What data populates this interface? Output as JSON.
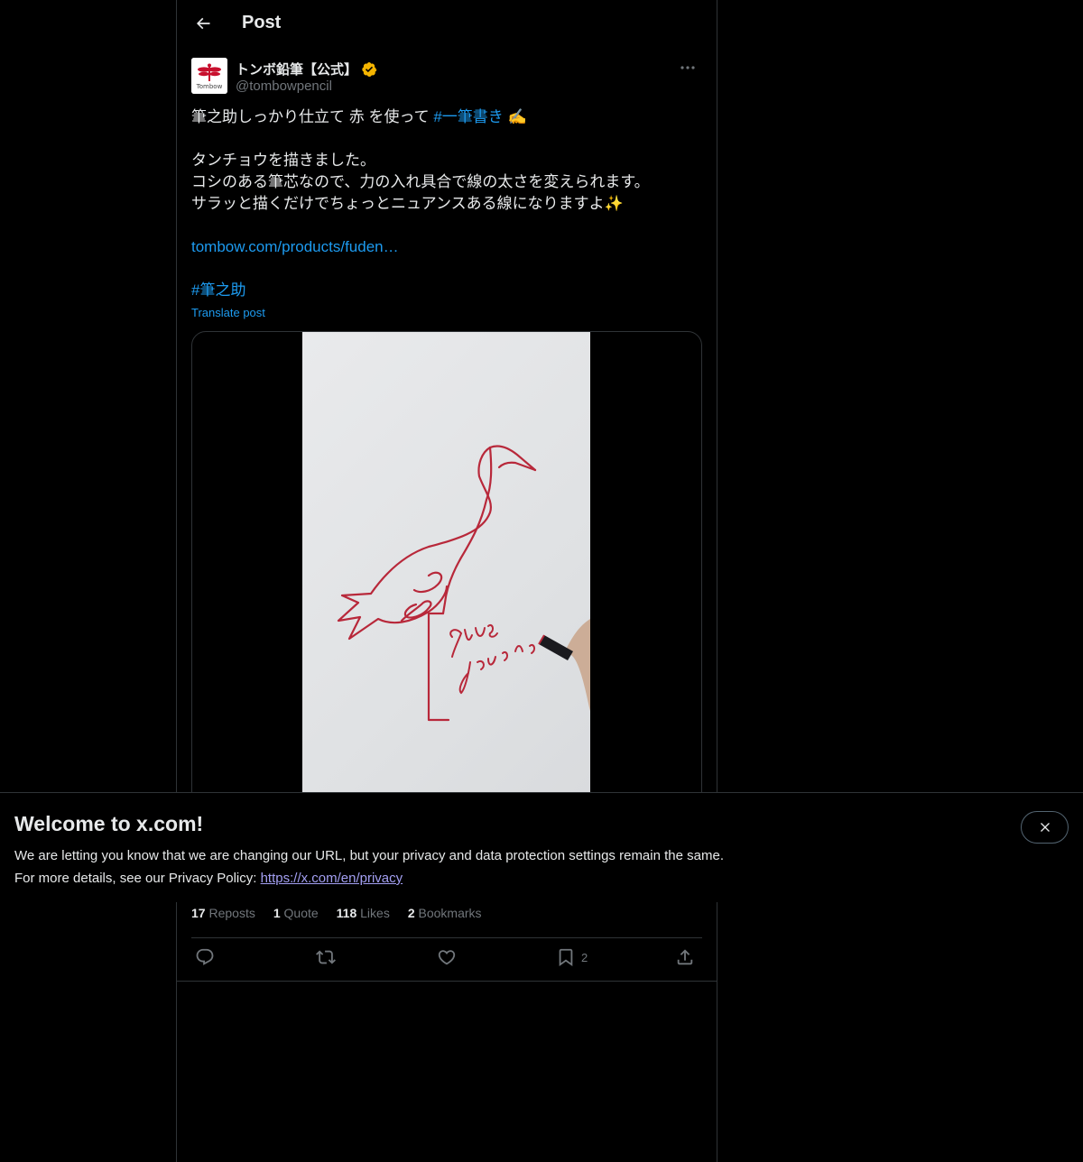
{
  "header": {
    "title": "Post"
  },
  "author": {
    "name": "トンボ鉛筆【公式】",
    "handle": "@tombowpencil",
    "avatar_text": "Tombow"
  },
  "tweet": {
    "line1_prefix": "筆之助しっかり仕立て 赤 を使って ",
    "hashtag1": "#一筆書き",
    "line1_emoji": " ✍️",
    "line2": "タンチョウを描きました。",
    "line3": "コシのある筆芯なので、力の入れ具合で線の太さを変えられます。",
    "line4": "サラッと描くだけでちょっとニュアンスある線になりますよ✨",
    "url": "tombow.com/products/fuden…",
    "hashtag2": "#筆之助",
    "translate": "Translate post"
  },
  "media": {
    "caption_line1": "grus",
    "caption_line2": "japonensis"
  },
  "stats": {
    "reposts_count": "17",
    "reposts_label": "Reposts",
    "quotes_count": "1",
    "quotes_label": "Quote",
    "likes_count": "118",
    "likes_label": "Likes",
    "bookmarks_count": "2",
    "bookmarks_label": "Bookmarks"
  },
  "actions": {
    "bookmark_count": "2"
  },
  "banner": {
    "title": "Welcome to x.com!",
    "line1": "We are letting you know that we are changing our URL, but your privacy and data protection settings remain the same.",
    "line2_prefix": "For more details, see our Privacy Policy: ",
    "link": "https://x.com/en/privacy"
  },
  "colors": {
    "background": "#000000",
    "text": "#e7e9ea",
    "muted": "#71767b",
    "accent": "#1d9bf0",
    "verified": "#f4b400",
    "border": "#2f3336"
  }
}
